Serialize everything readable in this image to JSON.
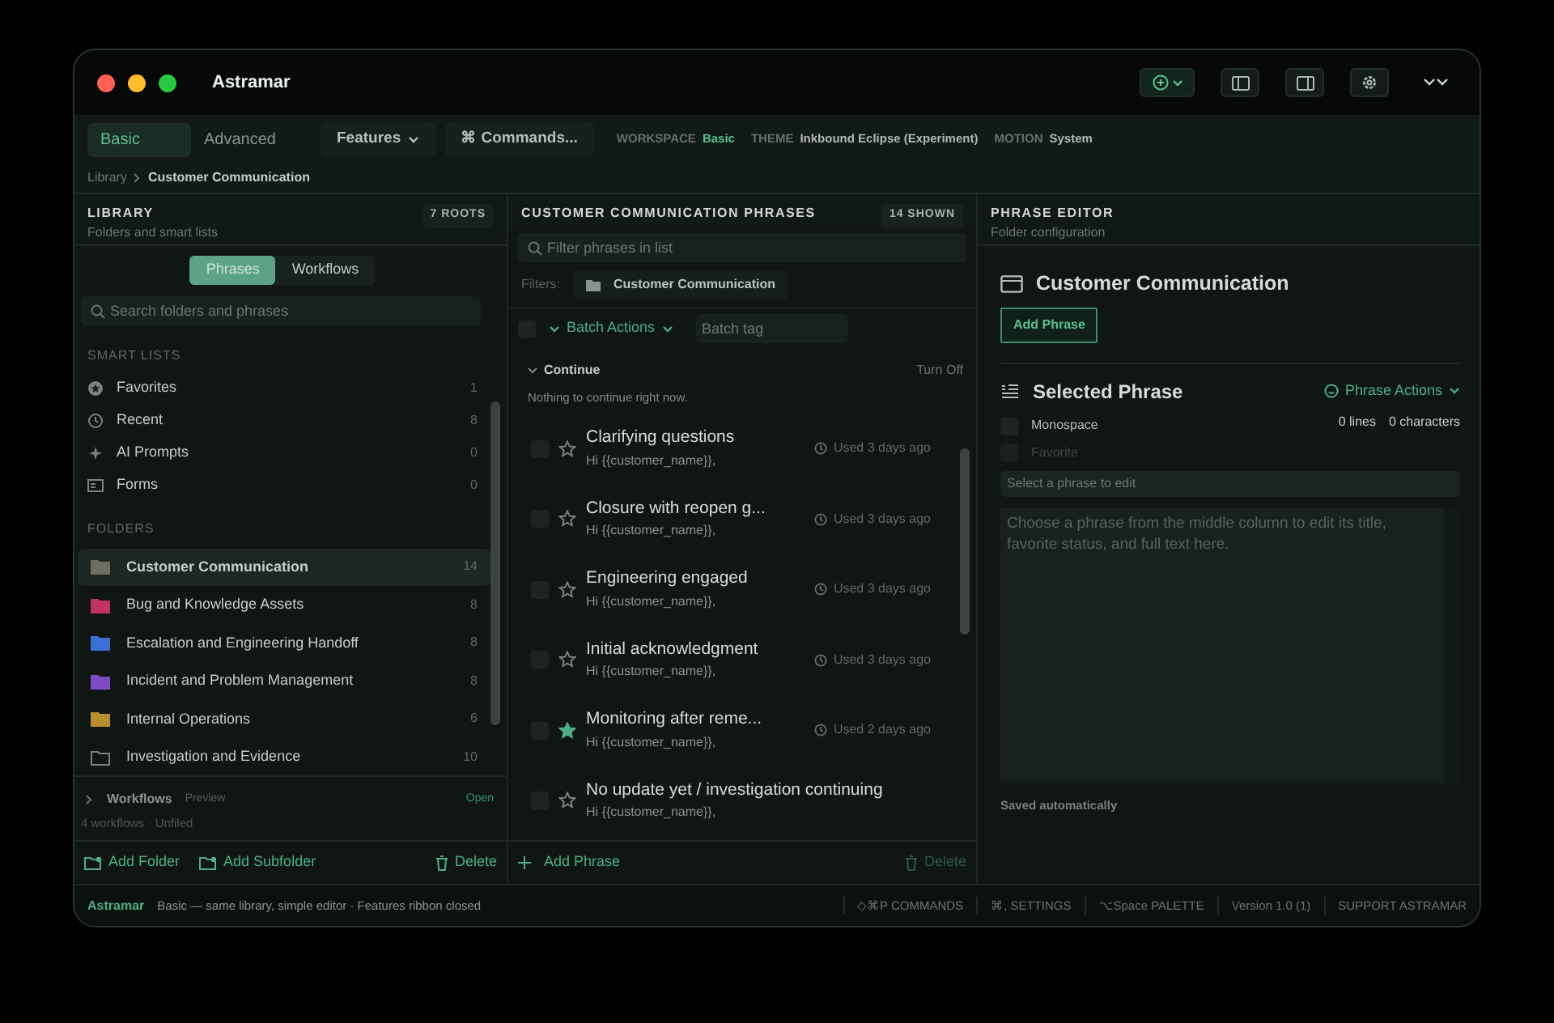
{
  "window": {
    "title": "Astramar"
  },
  "ribbon": {
    "modes": [
      {
        "label": "Basic",
        "selected": true
      },
      {
        "label": "Advanced",
        "selected": false
      }
    ],
    "features": "Features",
    "commands": "⌘ Commands...",
    "info": [
      {
        "label": "WORKSPACE",
        "value": "Basic",
        "accent": true
      },
      {
        "label": "THEME",
        "value": "Inkbound Eclipse (Experiment)",
        "accent": false
      },
      {
        "label": "MOTION",
        "value": "System",
        "accent": false
      }
    ]
  },
  "breadcrumb": [
    "Library",
    "Customer Communication"
  ],
  "library": {
    "title": "LIBRARY",
    "subtitle": "Folders and smart lists",
    "badge": "7 ROOTS",
    "tabs": [
      {
        "label": "Phrases",
        "selected": true
      },
      {
        "label": "Workflows",
        "selected": false
      }
    ],
    "search": {
      "placeholder": "Search folders and phrases"
    },
    "smart_lists_heading": "SMART LISTS",
    "smart_lists": [
      {
        "label": "Favorites",
        "count": "1",
        "kind": "star"
      },
      {
        "label": "Recent",
        "count": "8",
        "kind": "clock"
      },
      {
        "label": "AI Prompts",
        "count": "0",
        "kind": "sparkle"
      },
      {
        "label": "Forms",
        "count": "0",
        "kind": "form"
      }
    ],
    "folders_heading": "FOLDERS",
    "folders": [
      {
        "label": "Customer Communication",
        "count": "14",
        "color": "#6e6e62",
        "selected": true
      },
      {
        "label": "Bug and Knowledge Assets",
        "count": "8",
        "color": "#c03462",
        "selected": false
      },
      {
        "label": "Escalation and Engineering Handoff",
        "count": "8",
        "color": "#3b6fd4",
        "selected": false
      },
      {
        "label": "Incident and Problem Management",
        "count": "8",
        "color": "#7d4cc4",
        "selected": false
      },
      {
        "label": "Internal Operations",
        "count": "6",
        "color": "#b88f2c",
        "selected": false
      },
      {
        "label": "Investigation and Evidence",
        "count": "10",
        "color": "#0f1613",
        "selected": false
      }
    ],
    "workflows": {
      "label": "Workflows",
      "tag": "Preview",
      "action": "Open",
      "summary": "4 workflows · Unfiled",
      "expanded": false
    },
    "footer": {
      "add_folder": "Add Folder",
      "add_subfolder": "Add Subfolder",
      "delete": "Delete"
    }
  },
  "phrases": {
    "title": "CUSTOMER COMMUNICATION PHRASES",
    "badge": "14 SHOWN",
    "filter": {
      "placeholder": "Filter phrases in list"
    },
    "filters_label": "Filters:",
    "filter_chip": "Customer Communication",
    "batch": {
      "checked": false,
      "label": "Batch Actions",
      "tag_placeholder": "Batch tag"
    },
    "continue": {
      "label": "Continue",
      "action": "Turn Off",
      "message": "Nothing to continue right now.",
      "expanded": true
    },
    "items": [
      {
        "title": "Clarifying questions",
        "preview": "Hi {{customer_name}},",
        "used": "Used 3 days ago",
        "favorite": false,
        "checked": false
      },
      {
        "title": "Closure with reopen g...",
        "preview": "Hi {{customer_name}},",
        "used": "Used 3 days ago",
        "favorite": false,
        "checked": false
      },
      {
        "title": "Engineering engaged",
        "preview": "Hi {{customer_name}},",
        "used": "Used 3 days ago",
        "favorite": false,
        "checked": false
      },
      {
        "title": "Initial acknowledgment",
        "preview": "Hi {{customer_name}},",
        "used": "Used 3 days ago",
        "favorite": false,
        "checked": false
      },
      {
        "title": "Monitoring after reme...",
        "preview": "Hi {{customer_name}},",
        "used": "Used 2 days ago",
        "favorite": true,
        "checked": false
      },
      {
        "title": "No update yet / investigation continuing",
        "preview": "Hi {{customer_name}},",
        "favorite": false,
        "checked": false
      }
    ],
    "footer": {
      "add": "Add Phrase",
      "delete": "Delete",
      "delete_disabled": true
    }
  },
  "editor": {
    "title": "PHRASE EDITOR",
    "subtitle": "Folder configuration",
    "folder_name": "Customer Communication",
    "add_button": "Add Phrase",
    "selected_heading": "Selected Phrase",
    "actions": "Phrase Actions",
    "options": [
      {
        "label": "Monospace",
        "checked": false,
        "disabled": false
      },
      {
        "label": "Favorite",
        "checked": false,
        "disabled": true
      }
    ],
    "stats": [
      "0 lines",
      "0 characters"
    ],
    "title_placeholder": "Select a phrase to edit",
    "body_placeholder": "Choose a phrase from the middle column to edit its title, favorite status, and full text here.",
    "saved": "Saved automatically"
  },
  "status_bar": {
    "brand": "Astramar",
    "message": "Basic — same library, simple editor · Features ribbon closed",
    "items": [
      "◇⌘P COMMANDS",
      "⌘, SETTINGS",
      "⌥Space PALETTE",
      "Version 1.0 (1)",
      "SUPPORT ASTRAMAR"
    ]
  }
}
